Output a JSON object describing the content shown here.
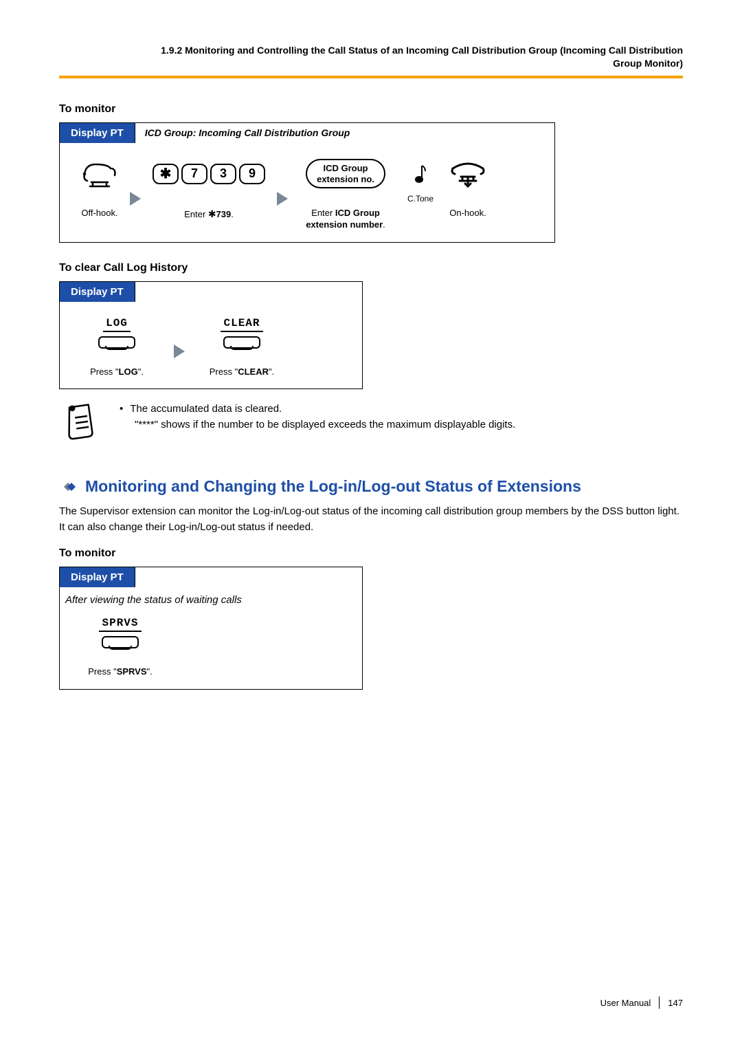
{
  "header_line1": "1.9.2 Monitoring and Controlling the Call Status of an Incoming Call Distribution Group (Incoming Call Distribution",
  "header_line2": "Group Monitor)",
  "proc1_heading": "To monitor",
  "proc1_tab": "Display PT",
  "proc1_banner": "ICD Group: Incoming Call Distribution Group",
  "proc1_step1": "Off-hook.",
  "proc1_keys": [
    "*",
    "7",
    "3",
    "9"
  ],
  "proc1_step2_pre": "Enter ",
  "proc1_step2_bold": "739",
  "proc1_step2_post": ".",
  "proc1_slot_line1": "ICD Group",
  "proc1_slot_line2": "extension no.",
  "proc1_step3_pre": "Enter ",
  "proc1_step3_bold1": "ICD Group",
  "proc1_step3_bold2": "extension number",
  "proc1_step3_post": ".",
  "proc1_ctone": "C.Tone",
  "proc1_step4": "On-hook.",
  "proc2_heading": "To clear Call Log History",
  "proc2_tab": "Display PT",
  "proc2_soft1": "LOG",
  "proc2_soft2": "CLEAR",
  "proc2_step1_pre": "Press \"",
  "proc2_step1_bold": "LOG",
  "proc2_step1_post": "\".",
  "proc2_step2_pre": "Press \"",
  "proc2_step2_bold": "CLEAR",
  "proc2_step2_post": "\".",
  "note_line1": "The accumulated data is cleared.",
  "note_line2": "\"****\" shows if the number to be displayed exceeds the maximum displayable digits.",
  "section_heading": "Monitoring and Changing the Log-in/Log-out Status of Extensions",
  "section_para": "The Supervisor extension can monitor the Log-in/Log-out status of the incoming call distribution group members by the DSS button light. It can also change their Log-in/Log-out status if needed.",
  "proc3_heading": "To monitor",
  "proc3_tab": "Display PT",
  "proc3_after": "After viewing the status of waiting calls",
  "proc3_soft": "SPRVS",
  "proc3_step_pre": "Press \"",
  "proc3_step_bold": "SPRVS",
  "proc3_step_post": "\".",
  "footer_label": "User Manual",
  "footer_page": "147"
}
